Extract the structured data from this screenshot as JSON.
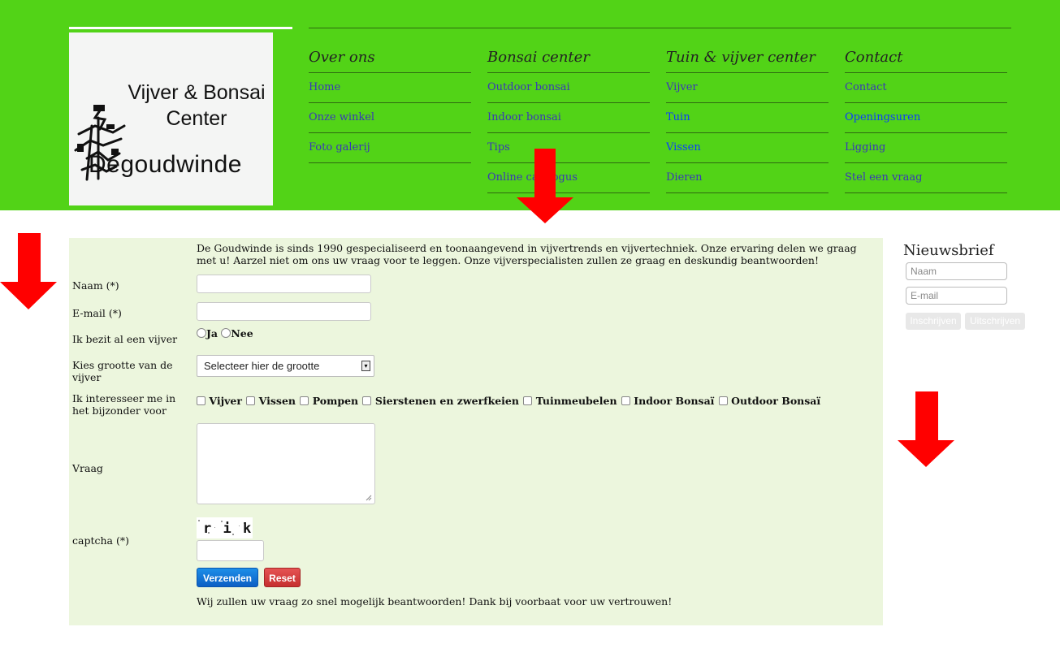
{
  "logo": {
    "line1": "Vijver & Bonsai",
    "line2": "Center",
    "line3": "Degoudwinde"
  },
  "nav": [
    {
      "heading": "Over ons",
      "links": [
        "Home",
        "Onze winkel",
        "Foto galerij"
      ]
    },
    {
      "heading": "Bonsai center",
      "links": [
        "Outdoor bonsai",
        "Indoor bonsai",
        "Tips",
        "Online catalogus"
      ]
    },
    {
      "heading": "Tuin & vijver center",
      "links": [
        "Vijver",
        "Tuin",
        "Vissen",
        "Dieren"
      ]
    },
    {
      "heading": "Contact",
      "links": [
        "Contact",
        "Openingsuren",
        "Ligging",
        "Stel een vraag"
      ]
    }
  ],
  "form": {
    "intro": "De Goudwinde is sinds 1990 gespecialiseerd en toonaangevend in vijvertrends en vijvertechniek. Onze ervaring delen we graag met u! Aarzel niet om ons uw vraag voor te leggen. Onze vijverspecialisten zullen ze graag en deskundig beantwoorden!",
    "name_label": "Naam (*)",
    "email_label": "E-mail (*)",
    "pond_label": "Ik bezit al een vijver",
    "pond_yes": "Ja",
    "pond_no": "Nee",
    "size_label": "Kies grootte van de vijver",
    "size_selected": "Selecteer hier de grootte",
    "interest_label": "Ik interesseer me in het bijzonder voor",
    "interests": [
      "Vijver",
      "Vissen",
      "Pompen",
      "Sierstenen en zwerfkeien",
      "Tuinmeubelen",
      "Indoor Bonsaï",
      "Outdoor Bonsaï"
    ],
    "question_label": "Vraag",
    "captcha_label": "captcha (*)",
    "captcha_text": "r i kr",
    "submit": "Verzenden",
    "reset": "Reset",
    "outro": "Wij zullen uw vraag zo snel mogelijk beantwoorden! Dank bij voorbaat voor uw vertrouwen!"
  },
  "newsletter": {
    "title": "Nieuwsbrief",
    "name_placeholder": "Naam",
    "email_placeholder": "E-mail",
    "subscribe": "Inschrijven",
    "unsubscribe": "Uitschrijven"
  },
  "colors": {
    "header_bg": "#52d317",
    "form_bg": "#ecf6dd",
    "arrow": "#ff0000",
    "link": "#3a37b8",
    "visited_link": "#0b3bff"
  }
}
